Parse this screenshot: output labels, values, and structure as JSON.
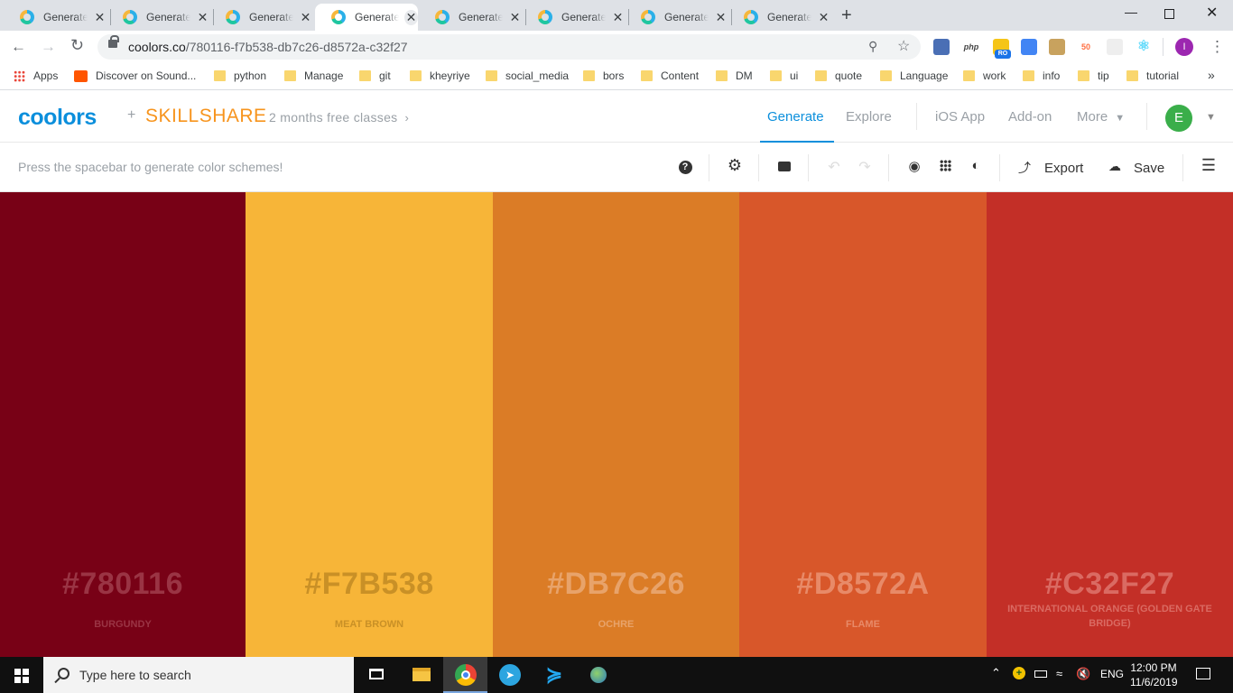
{
  "browser": {
    "tabs": [
      {
        "title": "Generate"
      },
      {
        "title": "Generate"
      },
      {
        "title": "Generate"
      },
      {
        "title": "Generate",
        "active": true
      },
      {
        "title": "Generate"
      },
      {
        "title": "Generate"
      },
      {
        "title": "Generate"
      },
      {
        "title": "Generate"
      }
    ],
    "close_glyph": "✕",
    "new_tab_glyph": "+",
    "url_host": "coolors.co",
    "url_path": "/780116-f7b538-db7c26-d8572a-c32f27",
    "profile_initial": "I",
    "ext_ro_badge": "RO",
    "ext_php": "php",
    "ext_50": "50",
    "bookmarks": [
      "Apps",
      "Discover on Sound...",
      "python",
      "Manage",
      "git",
      "kheyriye",
      "social_media",
      "bors",
      "Content",
      "DM",
      "ui",
      "quote",
      "Language",
      "work",
      "info",
      "tip",
      "tutorial"
    ],
    "bookmarks_more": "»"
  },
  "site": {
    "logo": "coolors",
    "plus": "+",
    "partner": "SKILLSHARE",
    "promo": "2 months free classes",
    "nav": [
      "Generate",
      "Explore",
      "iOS App",
      "Add-on",
      "More"
    ],
    "avatar_initial": "E"
  },
  "toolbar": {
    "hint": "Press the spacebar to generate color schemes!",
    "export_label": "Export",
    "save_label": "Save"
  },
  "palette": [
    {
      "hex": "#780116",
      "name": "BURGUNDY",
      "bg": "#780116",
      "fg": "#9a3444"
    },
    {
      "hex": "#F7B538",
      "name": "MEAT BROWN",
      "bg": "#F7B538",
      "fg": "#c99026"
    },
    {
      "hex": "#DB7C26",
      "name": "OCHRE",
      "bg": "#DB7C26",
      "fg": "#e8a36a"
    },
    {
      "hex": "#D8572A",
      "name": "FLAME",
      "bg": "#D8572A",
      "fg": "#e88a68"
    },
    {
      "hex": "#C32F27",
      "name": "INTERNATIONAL ORANGE (GOLDEN GATE BRIDGE)",
      "bg": "#C32F27",
      "fg": "#da6a62"
    }
  ],
  "taskbar": {
    "search_placeholder": "Type here to search",
    "language": "ENG",
    "time": "12:00 PM",
    "date": "11/6/2019"
  }
}
